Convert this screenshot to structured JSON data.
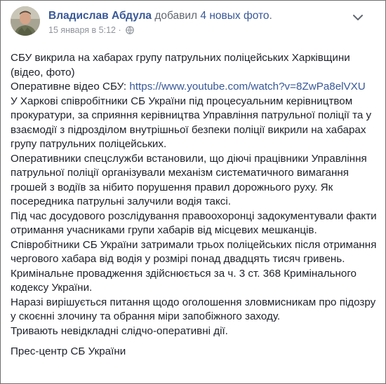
{
  "post": {
    "author": "Владислав Абдула",
    "action_prefix": "добавил",
    "action_link": "4 новых фото",
    "action_suffix": ".",
    "timestamp": "15 января в 5:12",
    "separator": " · ",
    "title": "СБУ викрила на хабарах групу патрульних поліцейських Харківщини (відео, фото)",
    "video_label": "Оперативне відео СБУ: ",
    "video_url": "https://www.youtube.com/watch?v=8ZwPa8elVXU",
    "paragraphs": [
      "У Харкові співробітники СБ України під процесуальним керівництвом прокуратури, за сприяння керівництва Управління патрульної поліції та у взаємодії з підрозділом внутрішньої безпеки поліції викрили на хабарах групу патрульних поліцейських.",
      "Оперативники спецслужби встановили, що діючі працівники Управління патрульної поліції організували механізм систематичного вимагання грошей з водіїв за нібито порушення правил дорожнього руху. Як посередника патрульні залучили водія таксі.",
      "Під час досудового розслідування правоохоронці задокументували факти отримання учасниками групи хабарів від місцевих мешканців.",
      "Співробітники СБ України затримали трьох поліцейських після отримання чергового хабара від водія у розмірі понад двадцять тисяч гривень.",
      "Кримінальне провадження здійснюється за ч. 3 ст. 368 Кримінального кодексу України.",
      "Наразі вирішується питання щодо оголошення зловмисникам про підозру у скоєнні злочину та обрання міри запобіжного заходу.",
      "Тривають невідкладні слідчо-оперативні дії."
    ],
    "signature": "Прес-центр СБ України"
  },
  "icons": {
    "avatar": "avatar-photo",
    "audience": "globe-icon",
    "menu": "chevron-down-icon"
  }
}
